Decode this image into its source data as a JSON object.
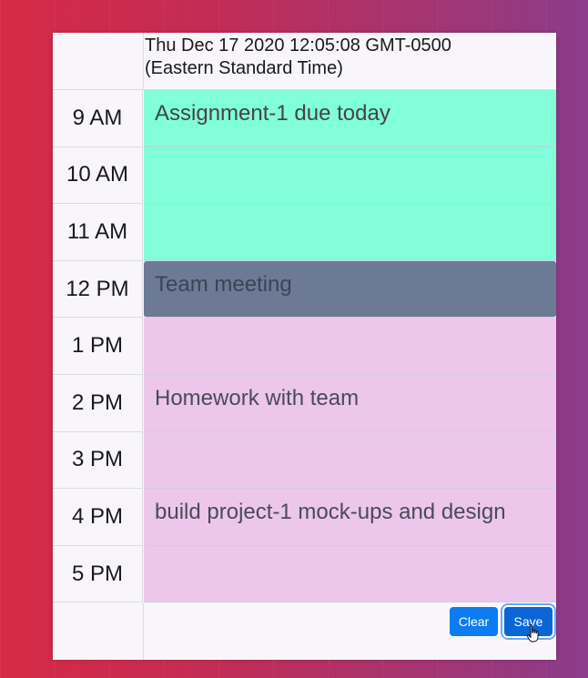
{
  "header": {
    "date_line1": "Thu Dec 17 2020 12:05:08 GMT-0500",
    "date_line2": "(Eastern Standard Time)"
  },
  "rows": [
    {
      "hour": "9 AM",
      "text": "Assignment-1 due today",
      "state": "future"
    },
    {
      "hour": "10 AM",
      "text": "",
      "state": "future"
    },
    {
      "hour": "11 AM",
      "text": "",
      "state": "future"
    },
    {
      "hour": "12 PM",
      "text": "Team meeting",
      "state": "present"
    },
    {
      "hour": "1 PM",
      "text": "",
      "state": "past"
    },
    {
      "hour": "2 PM",
      "text": "Homework with team",
      "state": "past"
    },
    {
      "hour": "3 PM",
      "text": "",
      "state": "past"
    },
    {
      "hour": "4 PM",
      "text": "build project-1 mock-ups and design",
      "state": "past"
    },
    {
      "hour": "5 PM",
      "text": "",
      "state": "past"
    }
  ],
  "buttons": {
    "clear_label": "Clear",
    "save_label": "Save"
  },
  "colors": {
    "future": "#80ffd9",
    "present": "#6d7a96",
    "past": "#ecc6eb",
    "button": "#0d7cf2"
  },
  "icons": {
    "cursor": "hand-pointer-icon"
  }
}
